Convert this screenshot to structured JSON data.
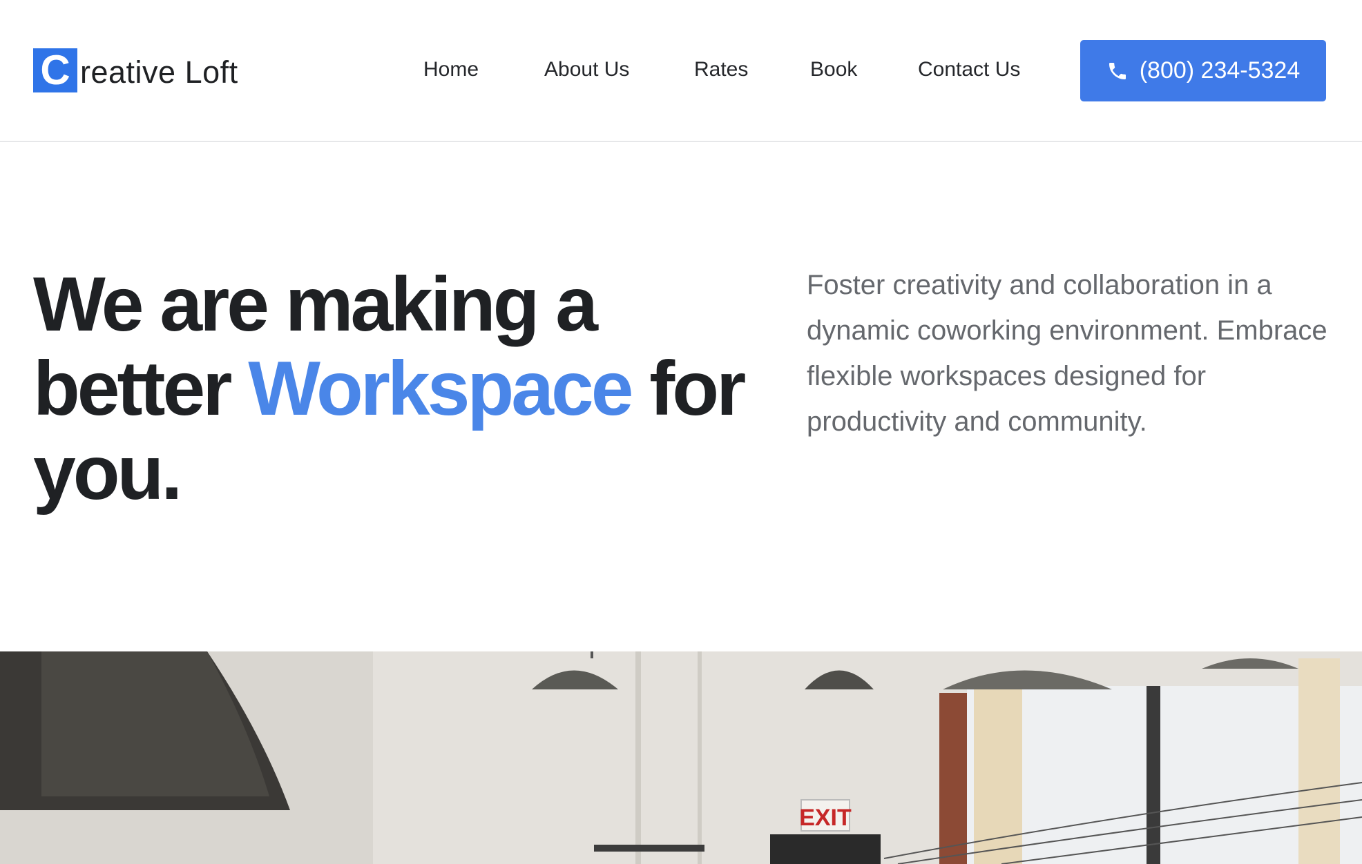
{
  "brand": {
    "logo_letter": "C",
    "logo_rest": "reative Loft",
    "accent_color": "#3f7ae8"
  },
  "nav": {
    "items": [
      {
        "label": "Home"
      },
      {
        "label": "About Us"
      },
      {
        "label": "Rates"
      },
      {
        "label": "Book"
      },
      {
        "label": "Contact Us"
      }
    ],
    "phone_icon": "phone-icon",
    "phone_label": "(800) 234-5324"
  },
  "hero": {
    "title_part1": "We are making a better ",
    "title_accent": "Workspace",
    "title_part2": " for you.",
    "description": "Foster creativity and collaboration in a dynamic coworking environment. Embrace flexible workspaces designed for productivity and community."
  },
  "photo": {
    "exit_sign": "EXIT"
  }
}
